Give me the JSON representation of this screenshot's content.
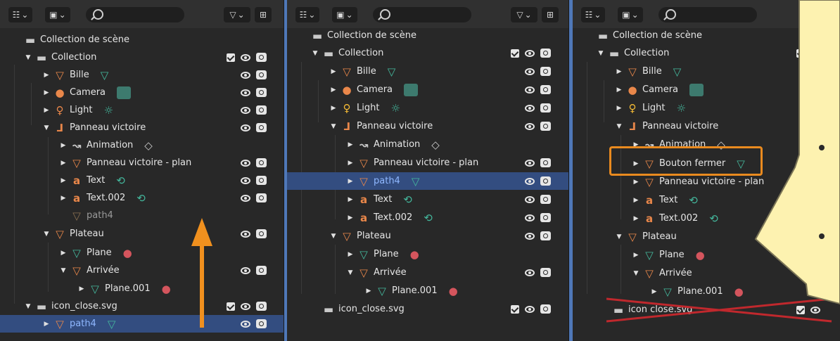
{
  "p1": {
    "rows": [
      {
        "label": "Collection de scène"
      },
      {
        "label": "Collection"
      },
      {
        "label": "Bille"
      },
      {
        "label": "Camera"
      },
      {
        "label": "Light"
      },
      {
        "label": "Panneau victoire"
      },
      {
        "label": "Animation"
      },
      {
        "label": "Panneau victoire - plan"
      },
      {
        "label": "Text"
      },
      {
        "label": "Text.002"
      },
      {
        "label": "path4"
      },
      {
        "label": "Plateau"
      },
      {
        "label": "Plane"
      },
      {
        "label": "Arrivée"
      },
      {
        "label": "Plane.001"
      },
      {
        "label": "icon_close.svg"
      },
      {
        "label": "path4"
      }
    ]
  },
  "p2": {
    "rows": [
      {
        "label": "Collection de scène"
      },
      {
        "label": "Collection"
      },
      {
        "label": "Bille"
      },
      {
        "label": "Camera"
      },
      {
        "label": "Light"
      },
      {
        "label": "Panneau victoire"
      },
      {
        "label": "Animation"
      },
      {
        "label": "Panneau victoire - plan"
      },
      {
        "label": "path4"
      },
      {
        "label": "Text"
      },
      {
        "label": "Text.002"
      },
      {
        "label": "Plateau"
      },
      {
        "label": "Plane"
      },
      {
        "label": "Arrivée"
      },
      {
        "label": "Plane.001"
      },
      {
        "label": "icon_close.svg"
      }
    ]
  },
  "p3": {
    "rows": [
      {
        "label": "Collection de scène"
      },
      {
        "label": "Collection"
      },
      {
        "label": "Bille"
      },
      {
        "label": "Camera"
      },
      {
        "label": "Light"
      },
      {
        "label": "Panneau victoire"
      },
      {
        "label": "Animation"
      },
      {
        "label": "Bouton fermer"
      },
      {
        "label": "Panneau victoire - plan"
      },
      {
        "label": "Text"
      },
      {
        "label": "Text.002"
      },
      {
        "label": "Plateau"
      },
      {
        "label": "Plane"
      },
      {
        "label": "Arrivée"
      },
      {
        "label": "Plane.001"
      },
      {
        "label": "icon close.svg"
      }
    ]
  },
  "colors": {
    "background": "#4f78b8",
    "panel": "#282828",
    "selection": "#334d80",
    "highlight_box": "#e98a1f",
    "arrow": "#f0901e",
    "strike": "#c0282d",
    "callout": "#fdf2b0"
  },
  "icons": {
    "collection": "collection-icon",
    "mesh": "mesh-triangle-icon",
    "camera": "camera-icon",
    "light": "light-bulb-icon",
    "empty": "empty-axes-icon",
    "text": "text-a-icon",
    "curve": "curve-icon",
    "eye": "eye-icon",
    "render": "camera-render-icon",
    "filter": "filter-icon"
  }
}
